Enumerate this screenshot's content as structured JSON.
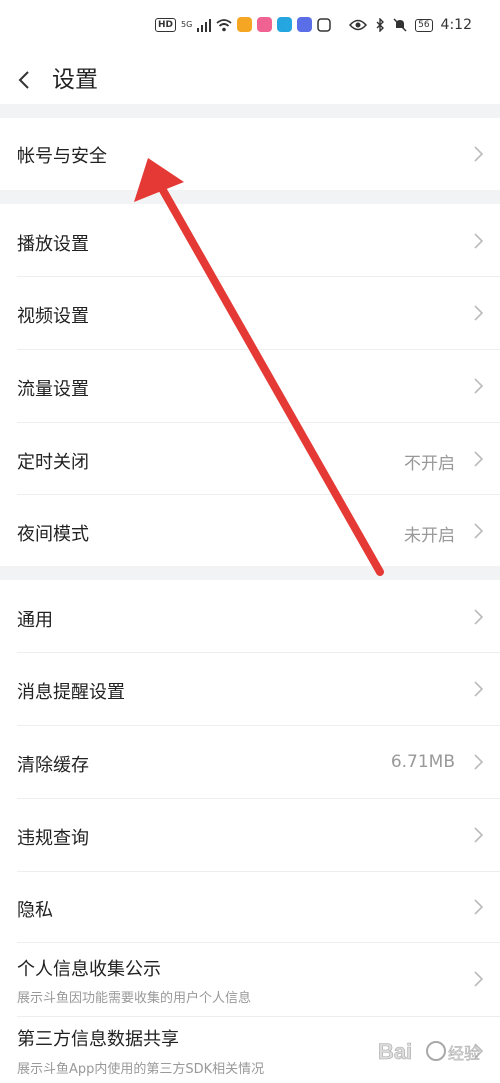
{
  "status_bar": {
    "hd": "HD",
    "network": "5G",
    "battery": "56",
    "time": "4:12",
    "app_colors": [
      "#f5a623",
      "#f06292",
      "#26a6e0",
      "#5a6ee8"
    ]
  },
  "header": {
    "title": "设置"
  },
  "sections": [
    {
      "items": [
        {
          "label": "帐号与安全"
        }
      ]
    },
    {
      "items": [
        {
          "label": "播放设置"
        },
        {
          "label": "视频设置"
        },
        {
          "label": "流量设置"
        },
        {
          "label": "定时关闭",
          "value": "不开启"
        },
        {
          "label": "夜间模式",
          "value": "未开启"
        }
      ]
    },
    {
      "items": [
        {
          "label": "通用"
        },
        {
          "label": "消息提醒设置"
        },
        {
          "label": "清除缓存",
          "value": "6.71MB"
        },
        {
          "label": "违规查询"
        },
        {
          "label": "隐私"
        },
        {
          "label": "个人信息收集公示",
          "sub": "展示斗鱼因功能需要收集的用户个人信息"
        },
        {
          "label": "第三方信息数据共享",
          "sub": "展示斗鱼App内使用的第三方SDK相关情况"
        }
      ]
    }
  ],
  "colors": {
    "annotation_arrow": "#e53935",
    "background_gap": "#f2f3f5"
  }
}
